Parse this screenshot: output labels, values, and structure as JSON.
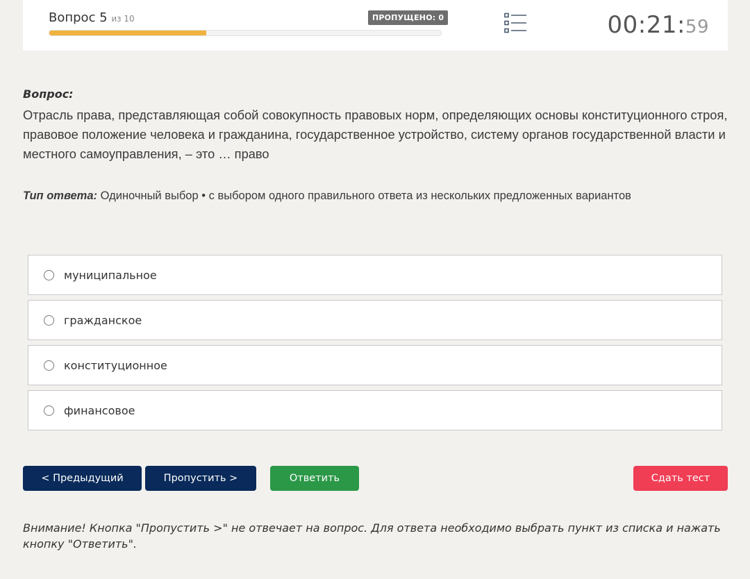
{
  "header": {
    "question_label": "Вопрос 5",
    "question_of": "из 10",
    "skipped_badge": "ПРОПУЩЕНО: 0",
    "progress_fraction": 0.4,
    "progress_color": "#f0b23e",
    "list_icon": "question-list-icon",
    "timer_main": "00:21:",
    "timer_seconds": "59"
  },
  "question": {
    "label": "Вопрос:",
    "text": "Отрасль права, представляющая собой совокупность правовых норм, определяющих основы конституционного строя, правовое положение человека и гражданина, государственное устройство, систему органов государственной власти и местного самоуправления, – это … право"
  },
  "answer_type": {
    "label": "Тип ответа:",
    "value": "Одиночный выбор • с выбором одного правильного ответа из нескольких предложенных вариантов"
  },
  "options": [
    {
      "label": "муниципальное"
    },
    {
      "label": "гражданское"
    },
    {
      "label": "конституционное"
    },
    {
      "label": "финансовое"
    }
  ],
  "buttons": {
    "prev": "< Предыдущий",
    "skip": "Пропустить >",
    "answer": "Ответить",
    "finish": "Сдать тест"
  },
  "colors": {
    "nav_button": "#092a5a",
    "answer_button": "#2b9848",
    "finish_button": "#f03e55"
  },
  "notice": "Внимание! Кнопка \"Пропустить >\" не отвечает на вопрос. Для ответа необходимо выбрать пункт из списка и нажать кнопку \"Ответить\"."
}
